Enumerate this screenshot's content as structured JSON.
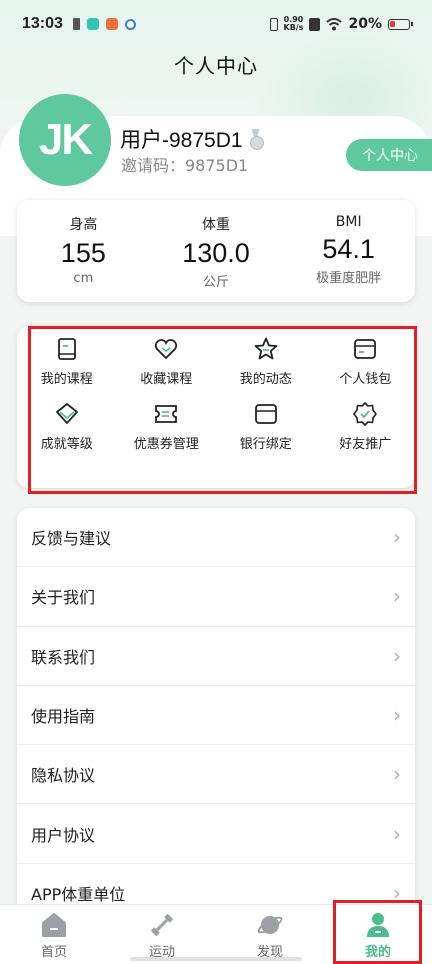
{
  "status_bar": {
    "time": "13:03",
    "speed_value": "0.90",
    "speed_unit": "KB/s",
    "battery": "20%"
  },
  "page_title": "个人中心",
  "profile": {
    "avatar_initials": "JK",
    "username": "用户-9875D1",
    "invite_label": "邀请码：9875D1",
    "profile_button": "个人中心"
  },
  "stats": [
    {
      "label": "身高",
      "value": "155",
      "unit": "cm"
    },
    {
      "label": "体重",
      "value": "130.0",
      "unit": "公斤"
    },
    {
      "label": "BMI",
      "value": "54.1",
      "unit": "极重度肥胖"
    }
  ],
  "grid": [
    {
      "label": "我的课程",
      "icon": "book-icon"
    },
    {
      "label": "收藏课程",
      "icon": "heart-icon"
    },
    {
      "label": "我的动态",
      "icon": "star-icon"
    },
    {
      "label": "个人钱包",
      "icon": "wallet-icon"
    },
    {
      "label": "成就等级",
      "icon": "diamond-icon"
    },
    {
      "label": "优惠券管理",
      "icon": "coupon-icon"
    },
    {
      "label": "银行绑定",
      "icon": "card-icon"
    },
    {
      "label": "好友推广",
      "icon": "badge-icon"
    }
  ],
  "menu": [
    {
      "label": "反馈与建议"
    },
    {
      "label": "关于我们"
    },
    {
      "label": "联系我们"
    },
    {
      "label": "使用指南"
    },
    {
      "label": "隐私协议"
    },
    {
      "label": "用户协议"
    },
    {
      "label": "APP体重单位"
    }
  ],
  "tabs": [
    {
      "label": "首页",
      "icon": "home-icon"
    },
    {
      "label": "运动",
      "icon": "dumbbell-icon"
    },
    {
      "label": "发现",
      "icon": "planet-icon"
    },
    {
      "label": "我的",
      "icon": "user-icon"
    }
  ],
  "colors": {
    "accent": "#5ec89e",
    "highlight_box": "#e31e24"
  }
}
